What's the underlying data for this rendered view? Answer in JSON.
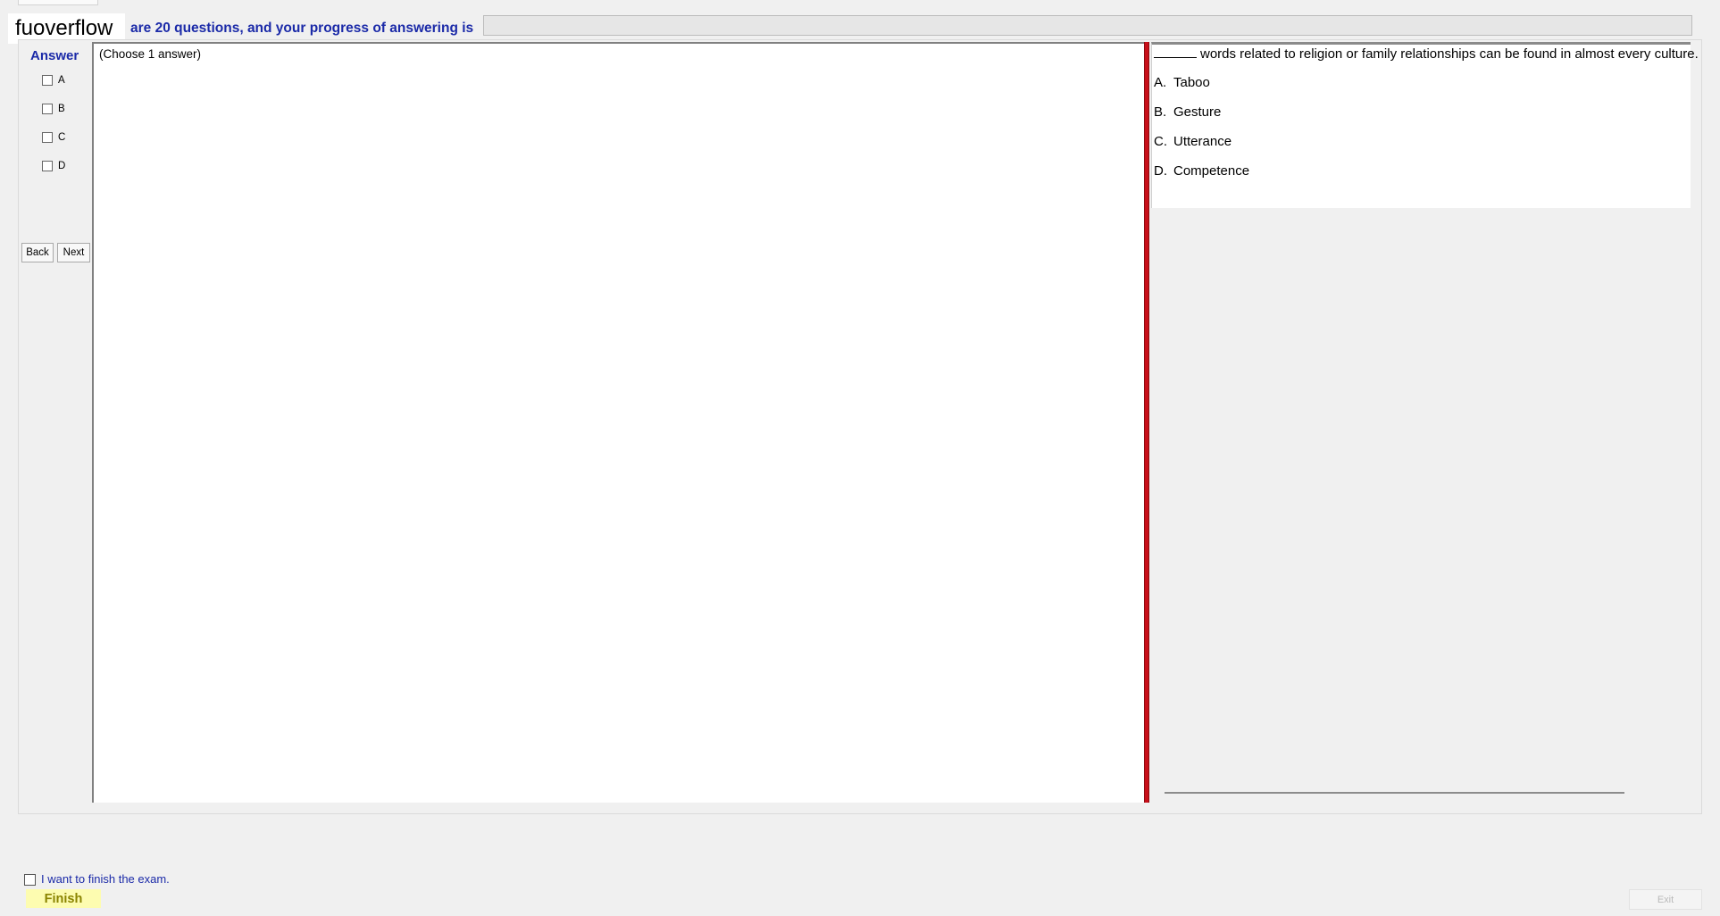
{
  "header": {
    "logo_text": "fuoverflow",
    "progress_text": "are 20 questions, and your progress of answering is"
  },
  "answer_panel": {
    "heading": "Answer",
    "options": [
      {
        "label": "A",
        "checked": false
      },
      {
        "label": "B",
        "checked": false
      },
      {
        "label": "C",
        "checked": false
      },
      {
        "label": "D",
        "checked": false
      }
    ],
    "back_label": "Back",
    "next_label": "Next"
  },
  "instruction": "(Choose 1 answer)",
  "question": {
    "text": "words related to religion or family relationships can be found in almost every culture.",
    "choices": [
      {
        "letter": "A.",
        "text": "Taboo"
      },
      {
        "letter": "B.",
        "text": "Gesture"
      },
      {
        "letter": "C.",
        "text": "Utterance"
      },
      {
        "letter": "D.",
        "text": "Competence"
      }
    ]
  },
  "footer": {
    "finish_checkbox_label": "I want to finish the exam.",
    "finish_label": "Finish",
    "exit_label": "Exit"
  },
  "colors": {
    "heading_blue": "#1b2aa8",
    "splitter_red": "#c8101a",
    "finish_bg": "#fdfcb0"
  }
}
